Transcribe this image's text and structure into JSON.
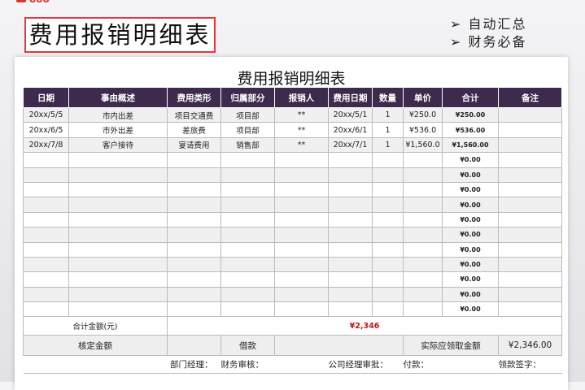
{
  "logo_text": "ooo",
  "banner_title": "费用报销明细表",
  "features": [
    "➢ 自动汇总",
    "➢ 财务必备"
  ],
  "sheet_title": "费用报销明细表",
  "columns": [
    "日期",
    "事由概述",
    "费用类形",
    "归属部分",
    "报销人",
    "费用日期",
    "数量",
    "单价",
    "合计",
    "备注"
  ],
  "rows": [
    [
      "20xx/5/5",
      "市内出差",
      "项目交通费",
      "项目部",
      "**",
      "20xx/5/1",
      "1",
      "¥250.0",
      "¥250.00",
      ""
    ],
    [
      "20xx/6/5",
      "市外出差",
      "差旅费",
      "项目部",
      "**",
      "20xx/6/1",
      "1",
      "¥536.0",
      "¥536.00",
      ""
    ],
    [
      "20xx/7/8",
      "客户接待",
      "宴请费用",
      "销售部",
      "**",
      "20xx/7/1",
      "1",
      "¥1,560.0",
      "¥1,560.00",
      ""
    ],
    [
      "",
      "",
      "",
      "",
      "",
      "",
      "",
      "",
      "¥0.00",
      ""
    ],
    [
      "",
      "",
      "",
      "",
      "",
      "",
      "",
      "",
      "¥0.00",
      ""
    ],
    [
      "",
      "",
      "",
      "",
      "",
      "",
      "",
      "",
      "¥0.00",
      ""
    ],
    [
      "",
      "",
      "",
      "",
      "",
      "",
      "",
      "",
      "¥0.00",
      ""
    ],
    [
      "",
      "",
      "",
      "",
      "",
      "",
      "",
      "",
      "¥0.00",
      ""
    ],
    [
      "",
      "",
      "",
      "",
      "",
      "",
      "",
      "",
      "¥0.00",
      ""
    ],
    [
      "",
      "",
      "",
      "",
      "",
      "",
      "",
      "",
      "¥0.00",
      ""
    ],
    [
      "",
      "",
      "",
      "",
      "",
      "",
      "",
      "",
      "¥0.00",
      ""
    ],
    [
      "",
      "",
      "",
      "",
      "",
      "",
      "",
      "",
      "¥0.00",
      ""
    ],
    [
      "",
      "",
      "",
      "",
      "",
      "",
      "",
      "",
      "¥0.00",
      ""
    ],
    [
      "",
      "",
      "",
      "",
      "",
      "",
      "",
      "",
      "¥0.00",
      ""
    ]
  ],
  "summary": {
    "total_label": "合计金额(元)",
    "total_value": "¥2,346",
    "approved_label": "核定金额",
    "loan_label": "借款",
    "actual_label": "实际应领取金额",
    "actual_value": "¥2,346.00"
  },
  "signatures": [
    "部门经理：",
    "财务审核：",
    "公司经理审批：",
    "付款：",
    "领款签字："
  ],
  "colors": {
    "header": "#3d2a4d",
    "accent": "#e5393d",
    "total": "#c0161e"
  }
}
